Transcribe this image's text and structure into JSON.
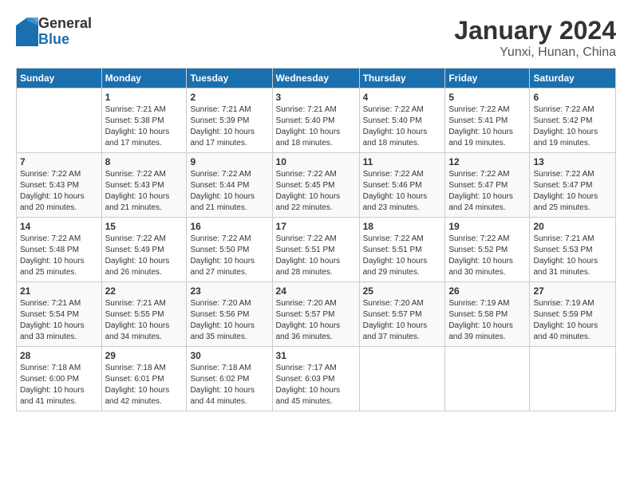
{
  "logo": {
    "general": "General",
    "blue": "Blue"
  },
  "header": {
    "title": "January 2024",
    "subtitle": "Yunxi, Hunan, China"
  },
  "days_of_week": [
    "Sunday",
    "Monday",
    "Tuesday",
    "Wednesday",
    "Thursday",
    "Friday",
    "Saturday"
  ],
  "weeks": [
    [
      {
        "day": "",
        "sunrise": "",
        "sunset": "",
        "daylight": ""
      },
      {
        "day": "1",
        "sunrise": "Sunrise: 7:21 AM",
        "sunset": "Sunset: 5:38 PM",
        "daylight": "Daylight: 10 hours and 17 minutes."
      },
      {
        "day": "2",
        "sunrise": "Sunrise: 7:21 AM",
        "sunset": "Sunset: 5:39 PM",
        "daylight": "Daylight: 10 hours and 17 minutes."
      },
      {
        "day": "3",
        "sunrise": "Sunrise: 7:21 AM",
        "sunset": "Sunset: 5:40 PM",
        "daylight": "Daylight: 10 hours and 18 minutes."
      },
      {
        "day": "4",
        "sunrise": "Sunrise: 7:22 AM",
        "sunset": "Sunset: 5:40 PM",
        "daylight": "Daylight: 10 hours and 18 minutes."
      },
      {
        "day": "5",
        "sunrise": "Sunrise: 7:22 AM",
        "sunset": "Sunset: 5:41 PM",
        "daylight": "Daylight: 10 hours and 19 minutes."
      },
      {
        "day": "6",
        "sunrise": "Sunrise: 7:22 AM",
        "sunset": "Sunset: 5:42 PM",
        "daylight": "Daylight: 10 hours and 19 minutes."
      }
    ],
    [
      {
        "day": "7",
        "sunrise": "Sunrise: 7:22 AM",
        "sunset": "Sunset: 5:43 PM",
        "daylight": "Daylight: 10 hours and 20 minutes."
      },
      {
        "day": "8",
        "sunrise": "Sunrise: 7:22 AM",
        "sunset": "Sunset: 5:43 PM",
        "daylight": "Daylight: 10 hours and 21 minutes."
      },
      {
        "day": "9",
        "sunrise": "Sunrise: 7:22 AM",
        "sunset": "Sunset: 5:44 PM",
        "daylight": "Daylight: 10 hours and 21 minutes."
      },
      {
        "day": "10",
        "sunrise": "Sunrise: 7:22 AM",
        "sunset": "Sunset: 5:45 PM",
        "daylight": "Daylight: 10 hours and 22 minutes."
      },
      {
        "day": "11",
        "sunrise": "Sunrise: 7:22 AM",
        "sunset": "Sunset: 5:46 PM",
        "daylight": "Daylight: 10 hours and 23 minutes."
      },
      {
        "day": "12",
        "sunrise": "Sunrise: 7:22 AM",
        "sunset": "Sunset: 5:47 PM",
        "daylight": "Daylight: 10 hours and 24 minutes."
      },
      {
        "day": "13",
        "sunrise": "Sunrise: 7:22 AM",
        "sunset": "Sunset: 5:47 PM",
        "daylight": "Daylight: 10 hours and 25 minutes."
      }
    ],
    [
      {
        "day": "14",
        "sunrise": "Sunrise: 7:22 AM",
        "sunset": "Sunset: 5:48 PM",
        "daylight": "Daylight: 10 hours and 25 minutes."
      },
      {
        "day": "15",
        "sunrise": "Sunrise: 7:22 AM",
        "sunset": "Sunset: 5:49 PM",
        "daylight": "Daylight: 10 hours and 26 minutes."
      },
      {
        "day": "16",
        "sunrise": "Sunrise: 7:22 AM",
        "sunset": "Sunset: 5:50 PM",
        "daylight": "Daylight: 10 hours and 27 minutes."
      },
      {
        "day": "17",
        "sunrise": "Sunrise: 7:22 AM",
        "sunset": "Sunset: 5:51 PM",
        "daylight": "Daylight: 10 hours and 28 minutes."
      },
      {
        "day": "18",
        "sunrise": "Sunrise: 7:22 AM",
        "sunset": "Sunset: 5:51 PM",
        "daylight": "Daylight: 10 hours and 29 minutes."
      },
      {
        "day": "19",
        "sunrise": "Sunrise: 7:22 AM",
        "sunset": "Sunset: 5:52 PM",
        "daylight": "Daylight: 10 hours and 30 minutes."
      },
      {
        "day": "20",
        "sunrise": "Sunrise: 7:21 AM",
        "sunset": "Sunset: 5:53 PM",
        "daylight": "Daylight: 10 hours and 31 minutes."
      }
    ],
    [
      {
        "day": "21",
        "sunrise": "Sunrise: 7:21 AM",
        "sunset": "Sunset: 5:54 PM",
        "daylight": "Daylight: 10 hours and 33 minutes."
      },
      {
        "day": "22",
        "sunrise": "Sunrise: 7:21 AM",
        "sunset": "Sunset: 5:55 PM",
        "daylight": "Daylight: 10 hours and 34 minutes."
      },
      {
        "day": "23",
        "sunrise": "Sunrise: 7:20 AM",
        "sunset": "Sunset: 5:56 PM",
        "daylight": "Daylight: 10 hours and 35 minutes."
      },
      {
        "day": "24",
        "sunrise": "Sunrise: 7:20 AM",
        "sunset": "Sunset: 5:57 PM",
        "daylight": "Daylight: 10 hours and 36 minutes."
      },
      {
        "day": "25",
        "sunrise": "Sunrise: 7:20 AM",
        "sunset": "Sunset: 5:57 PM",
        "daylight": "Daylight: 10 hours and 37 minutes."
      },
      {
        "day": "26",
        "sunrise": "Sunrise: 7:19 AM",
        "sunset": "Sunset: 5:58 PM",
        "daylight": "Daylight: 10 hours and 39 minutes."
      },
      {
        "day": "27",
        "sunrise": "Sunrise: 7:19 AM",
        "sunset": "Sunset: 5:59 PM",
        "daylight": "Daylight: 10 hours and 40 minutes."
      }
    ],
    [
      {
        "day": "28",
        "sunrise": "Sunrise: 7:18 AM",
        "sunset": "Sunset: 6:00 PM",
        "daylight": "Daylight: 10 hours and 41 minutes."
      },
      {
        "day": "29",
        "sunrise": "Sunrise: 7:18 AM",
        "sunset": "Sunset: 6:01 PM",
        "daylight": "Daylight: 10 hours and 42 minutes."
      },
      {
        "day": "30",
        "sunrise": "Sunrise: 7:18 AM",
        "sunset": "Sunset: 6:02 PM",
        "daylight": "Daylight: 10 hours and 44 minutes."
      },
      {
        "day": "31",
        "sunrise": "Sunrise: 7:17 AM",
        "sunset": "Sunset: 6:03 PM",
        "daylight": "Daylight: 10 hours and 45 minutes."
      },
      {
        "day": "",
        "sunrise": "",
        "sunset": "",
        "daylight": ""
      },
      {
        "day": "",
        "sunrise": "",
        "sunset": "",
        "daylight": ""
      },
      {
        "day": "",
        "sunrise": "",
        "sunset": "",
        "daylight": ""
      }
    ]
  ]
}
